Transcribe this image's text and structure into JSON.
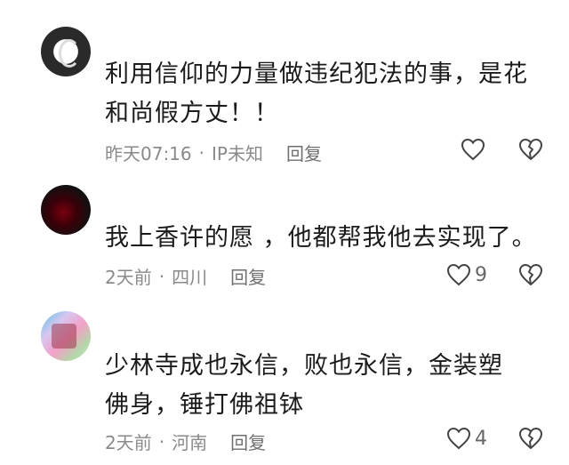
{
  "comments": [
    {
      "text": "利用信仰的力量做违纪犯法的事，是花和尚假方丈！！",
      "time": "昨天07:16",
      "location": "IP未知",
      "reply": "回复",
      "likes": ""
    },
    {
      "text": "我上香许的愿 ，他都帮我他去实现了。",
      "time": "2天前",
      "location": "四川",
      "reply": "回复",
      "likes": "9"
    },
    {
      "text": "少林寺成也永信，败也永信，金装塑佛身，锤打佛祖钵",
      "time": "2天前",
      "location": "河南",
      "reply": "回复",
      "likes": "4"
    }
  ],
  "separator": "·",
  "icons": {
    "like": "heart-outline-icon",
    "dislike": "broken-heart-icon"
  }
}
